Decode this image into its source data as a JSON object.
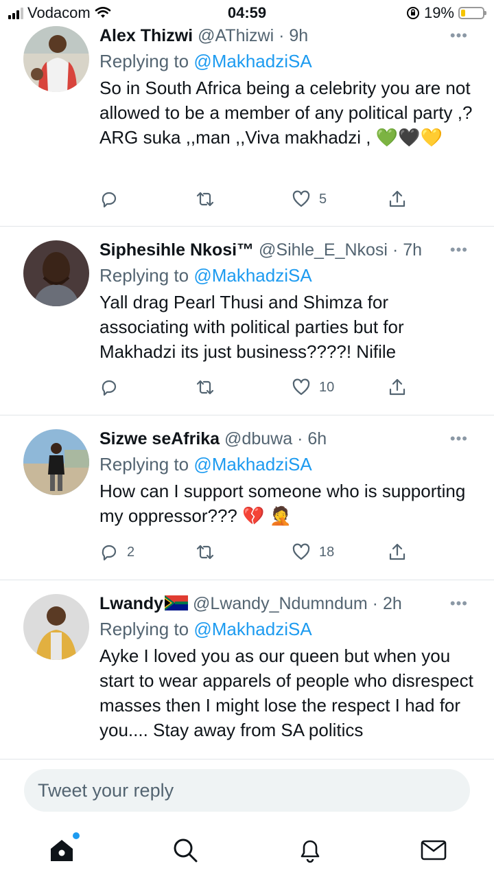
{
  "status_bar": {
    "carrier": "Vodacom",
    "time": "04:59",
    "battery_percent": "19%",
    "battery_level": 0.19
  },
  "tweets": [
    {
      "name": "Alex Thizwi",
      "handle": "@AThizwi",
      "age": "· 9h",
      "replying_prefix": "Replying to",
      "replying_to": "@MakhadziSA",
      "text": "So in South Africa being a celebrity you are not allowed to be a member of any political party ,? ARG suka ,,man ,,Viva makhadzi ,",
      "emoji": "💚🖤💛",
      "reply_count": "",
      "retweet_count": "",
      "like_count": "5"
    },
    {
      "name": "Siphesihle Nkosi™",
      "handle": "@Sihle_E_Nkosi",
      "age": "· 7h",
      "replying_prefix": "Replying to",
      "replying_to": "@MakhadziSA",
      "text": "Yall drag Pearl Thusi and Shimza for associating with political parties but for Makhadzi its just business????! Nifile",
      "emoji": "",
      "reply_count": "",
      "retweet_count": "",
      "like_count": "10"
    },
    {
      "name": "Sizwe seAfrika",
      "handle": "@dbuwa",
      "age": "· 6h",
      "replying_prefix": "Replying to",
      "replying_to": "@MakhadziSA",
      "text": "How can I support someone who is supporting my oppressor???",
      "emoji": "💔 🤦",
      "reply_count": "2",
      "retweet_count": "",
      "like_count": "18"
    },
    {
      "name": "Lwandy",
      "handle": "@Lwandy_Ndumndum",
      "age": "· 2h",
      "replying_prefix": "Replying to",
      "replying_to": "@MakhadziSA",
      "text": "Ayke I loved you as our queen but when you start to wear apparels of people who disrespect masses then I might lose the respect I had for you.... Stay away from SA politics",
      "emoji": "",
      "reply_count": "",
      "retweet_count": "",
      "like_count": ""
    }
  ],
  "composer": {
    "placeholder": "Tweet your reply"
  },
  "icons": {
    "reply": "reply-icon",
    "retweet": "retweet-icon",
    "like": "heart-icon",
    "share": "share-icon",
    "more": "more-icon",
    "home": "home-icon",
    "search": "search-icon",
    "notifications": "bell-icon",
    "messages": "mail-icon"
  },
  "colors": {
    "accent": "#1d9bf0",
    "muted": "#536471",
    "text": "#0f1419",
    "battery": "#f5c400"
  }
}
